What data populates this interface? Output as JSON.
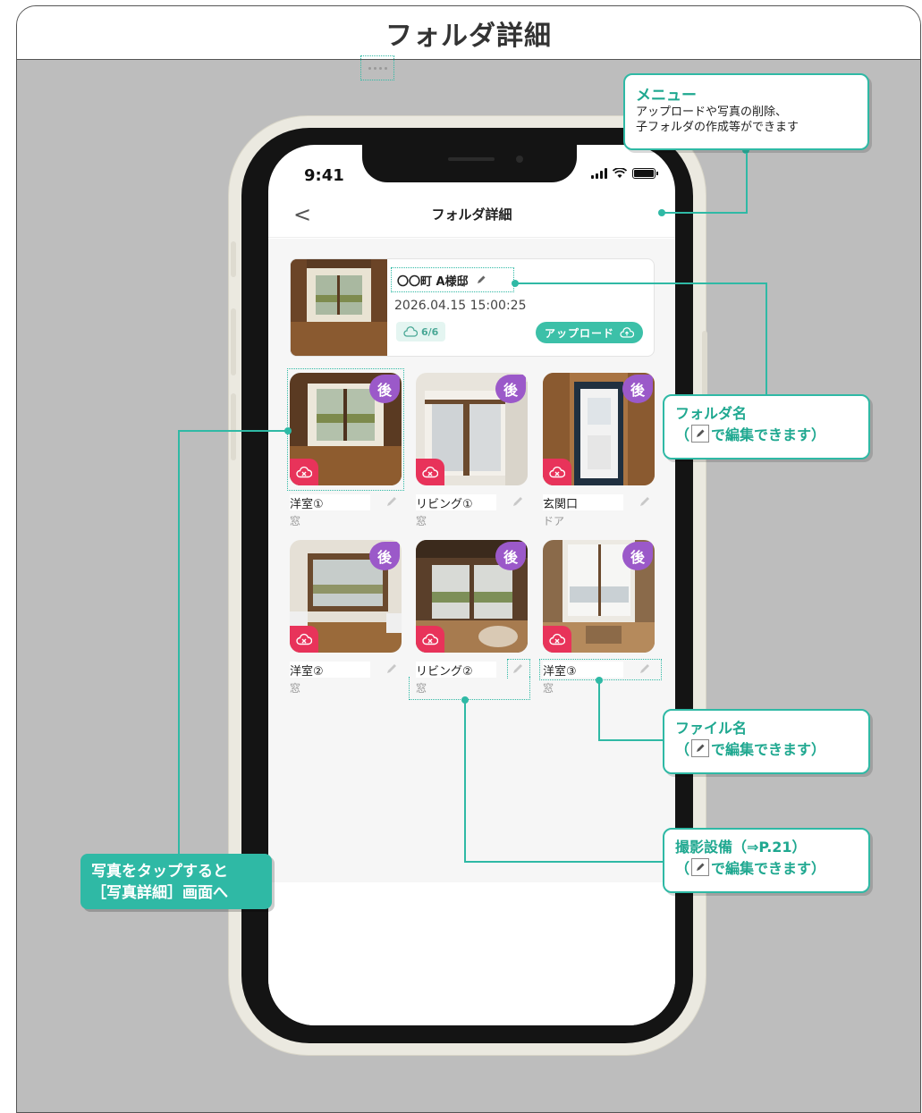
{
  "page": {
    "title": "フォルダ詳細"
  },
  "status_bar": {
    "time": "9:41"
  },
  "nav": {
    "back": "<",
    "title": "フォルダ詳細"
  },
  "folder": {
    "name": "〇〇町 A様邸",
    "date": "2026.04.15 15:00:25",
    "count": "6/6",
    "upload_label": "アップロード"
  },
  "photos": [
    {
      "name": "洋室①",
      "equipment": "窓",
      "badge": "後"
    },
    {
      "name": "リビング①",
      "equipment": "窓",
      "badge": "後"
    },
    {
      "name": "玄関口",
      "equipment": "ドア",
      "badge": "後"
    },
    {
      "name": "洋室②",
      "equipment": "窓",
      "badge": "後"
    },
    {
      "name": "リビング②",
      "equipment": "窓",
      "badge": "後"
    },
    {
      "name": "洋室③",
      "equipment": "窓",
      "badge": "後"
    }
  ],
  "callouts": {
    "menu": {
      "title": "メニュー",
      "line1": "アップロードや写真の削除、",
      "line2": "子フォルダの作成等ができます"
    },
    "folder_name": {
      "title": "フォルダ名",
      "note_prefix": "（",
      "note_suffix": "で編集できます）"
    },
    "file_name": {
      "title": "ファイル名",
      "note_prefix": "（",
      "note_suffix": "で編集できます）"
    },
    "equipment": {
      "title": "撮影設備（⇒P.21）",
      "note_prefix": "（",
      "note_suffix": "で編集できます）"
    },
    "tap_photo": {
      "line1": "写真をタップすると",
      "line2": "［写真詳細］画面へ"
    }
  },
  "colors": {
    "accent": "#2fb9a5",
    "badge_purple": "#9b59c9",
    "cloud_red": "#e8335a",
    "upload_green": "#3cc0a8"
  },
  "icons": {
    "menu": "more-dots-icon",
    "edit": "pencil-icon",
    "cloud": "cloud-off-icon",
    "upload": "cloud-upload-icon"
  }
}
